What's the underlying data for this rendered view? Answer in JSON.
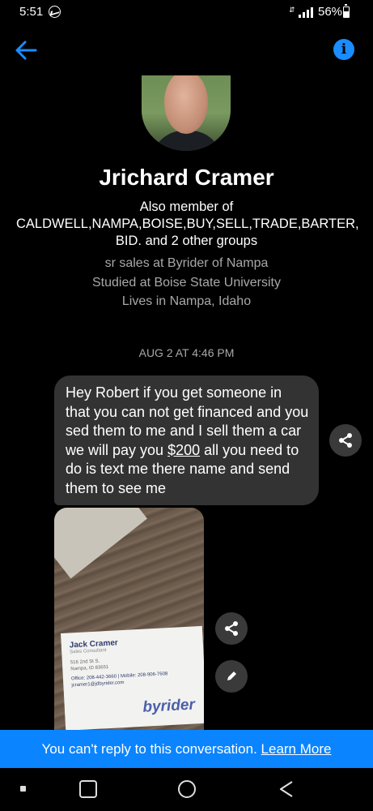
{
  "status_bar": {
    "time": "5:51",
    "battery": "56%"
  },
  "header": {
    "back_icon": "arrow-left-icon",
    "info_icon": "info-icon",
    "info_glyph": "i",
    "accent_color": "#1a8cff"
  },
  "profile": {
    "name": "Jrichard Cramer",
    "membership_line1": "Also member of",
    "membership_line2": "CALDWELL,NAMPA,BOISE,BUY,SELL,TRADE,BARTER,",
    "membership_line3": "BID. and 2 other groups",
    "detail_job": "sr sales at Byrider of Nampa",
    "detail_school": "Studied at Boise State University",
    "detail_city": "Lives in Nampa, Idaho"
  },
  "conversation": {
    "timestamp": "AUG 2 AT 4:46 PM",
    "message_before_link": "Hey Robert if you get someone in that you can not get financed and you sed them to me and I sell them a car we will pay you ",
    "message_link": "$200",
    "message_after_link": " all you need to do is text me there name and send them to see me",
    "photo_card": {
      "name": "Jack Cramer",
      "title": "Sales Consultant",
      "address_line1": "516 2nd St S.",
      "address_line2": "Nampa, ID 83651",
      "phones": "Office: 208-442-3660 | Mobile: 208-906-7608",
      "email": "jcramer1@jdbyrider.com",
      "logo": "byrider"
    }
  },
  "banner": {
    "text": "You can't reply to this conversation. ",
    "link": "Learn More",
    "color": "#0a84ff"
  },
  "nav": {
    "recents_icon": "recents-icon",
    "home_icon": "home-icon",
    "back_icon": "back-triangle-icon"
  }
}
